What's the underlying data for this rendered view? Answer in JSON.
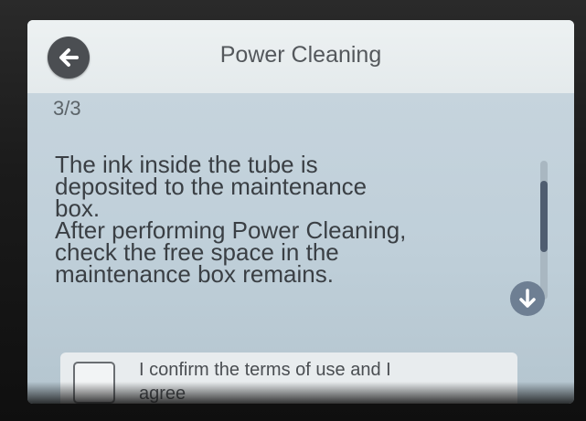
{
  "header": {
    "title": "Power Cleaning",
    "back_icon": "arrow-left-circle-icon"
  },
  "page": {
    "indicator": "3/3"
  },
  "message": {
    "lines": [
      "The ink inside the tube is",
      "deposited to the maintenance",
      "box.",
      "After performing Power Cleaning,",
      "check the free space in the",
      "maintenance box remains."
    ]
  },
  "scroll": {
    "down_icon": "arrow-down-circle-icon",
    "position": 0.3
  },
  "confirm": {
    "checked": false,
    "label_line1": "I confirm the terms of use and I",
    "label_line2": "agree"
  },
  "colors": {
    "screen_bg": "#c3d2dc",
    "header_bg": "#e8edee",
    "accent": "#4f5d70"
  }
}
